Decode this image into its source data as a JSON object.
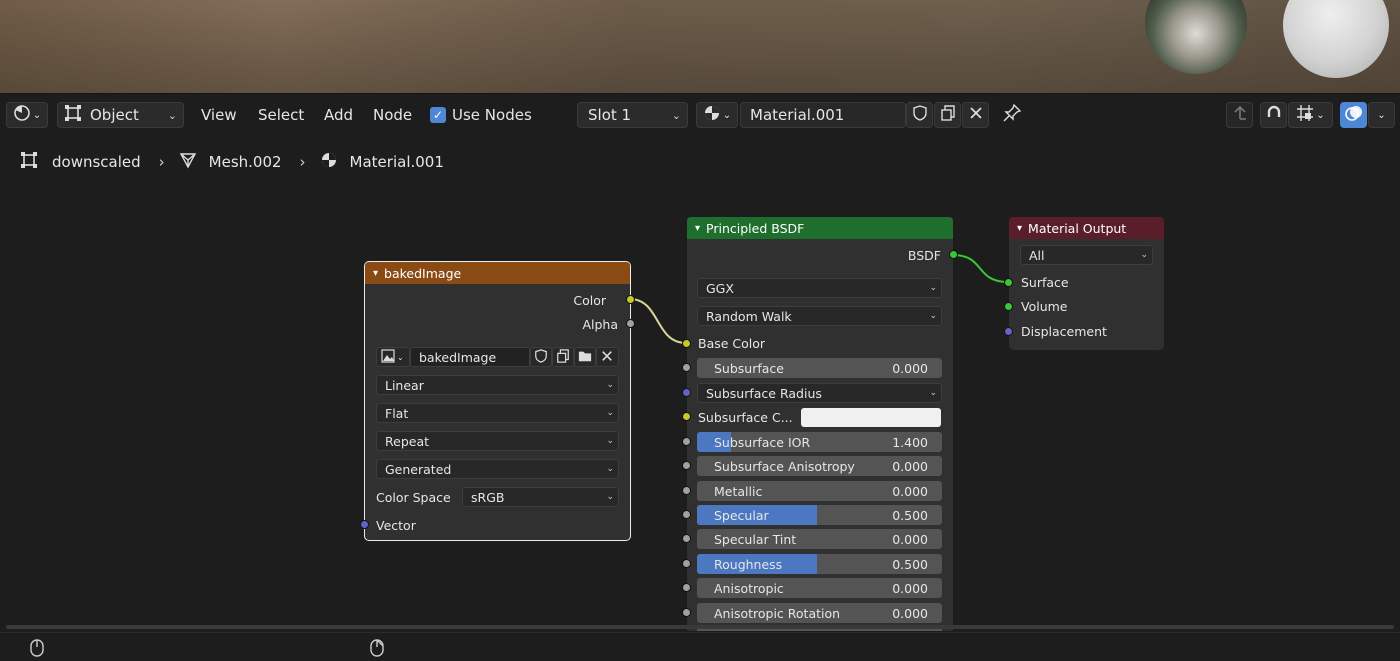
{
  "header": {
    "editor_type": "",
    "mode": "Object",
    "menus": [
      "View",
      "Select",
      "Add",
      "Node"
    ],
    "use_nodes_label": "Use Nodes",
    "use_nodes_checked": true,
    "slot": "Slot 1",
    "material_name": "Material.001"
  },
  "breadcrumb": {
    "object": "downscaled",
    "mesh": "Mesh.002",
    "material": "Material.001"
  },
  "image_node": {
    "title": "bakedImage",
    "header_color": "#8a4a14",
    "outputs": [
      "Color",
      "Alpha"
    ],
    "image_name": "bakedImage",
    "interpolation": "Linear",
    "projection": "Flat",
    "extension": "Repeat",
    "source": "Generated",
    "color_space_label": "Color Space",
    "color_space": "sRGB",
    "input": "Vector"
  },
  "bsdf_node": {
    "title": "Principled BSDF",
    "header_color": "#1e6e2e",
    "output": "BSDF",
    "distribution": "GGX",
    "subsurface_method": "Random Walk",
    "base_color_label": "Base Color",
    "subsurface_radius": "Subsurface Radius",
    "subsurface_color_label": "Subsurface C...",
    "sliders": [
      {
        "label": "Subsurface",
        "value": "0.000",
        "fill": 0
      },
      {
        "label": "Subsurface IOR",
        "value": "1.400",
        "fill": 0.14
      },
      {
        "label": "Subsurface Anisotropy",
        "value": "0.000",
        "fill": 0
      },
      {
        "label": "Metallic",
        "value": "0.000",
        "fill": 0
      },
      {
        "label": "Specular",
        "value": "0.500",
        "fill": 0.5
      },
      {
        "label": "Specular Tint",
        "value": "0.000",
        "fill": 0
      },
      {
        "label": "Roughness",
        "value": "0.500",
        "fill": 0.5
      },
      {
        "label": "Anisotropic",
        "value": "0.000",
        "fill": 0
      },
      {
        "label": "Anisotropic Rotation",
        "value": "0.000",
        "fill": 0
      }
    ]
  },
  "output_node": {
    "title": "Material Output",
    "header_color": "#5a1e2a",
    "target": "All",
    "inputs": [
      "Surface",
      "Volume",
      "Displacement"
    ]
  },
  "colors": {
    "socket_color": "#c7c729",
    "socket_gray": "#a1a1a1",
    "socket_vector": "#6363c7",
    "socket_shader": "#39c739",
    "accent": "#4d87d6"
  }
}
